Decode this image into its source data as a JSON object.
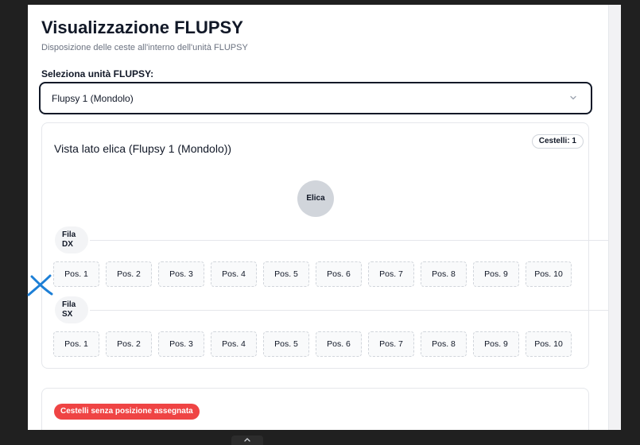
{
  "page": {
    "title": "Visualizzazione FLUPSY",
    "subtitle": "Disposizione delle ceste all'interno dell'unità FLUPSY"
  },
  "selector": {
    "label": "Seleziona unità FLUPSY:",
    "value": "Flupsy 1 (Mondolo)"
  },
  "view": {
    "title": "Vista lato elica (Flupsy 1 (Mondolo))",
    "count_badge": "Cestelli: 1",
    "propeller_label": "Elica",
    "rows": [
      {
        "label_line1": "Fila",
        "label_line2": "DX"
      },
      {
        "label_line1": "Fila",
        "label_line2": "SX"
      }
    ],
    "positions": [
      "Pos. 1",
      "Pos. 2",
      "Pos. 3",
      "Pos. 4",
      "Pos. 5",
      "Pos. 6",
      "Pos. 7",
      "Pos. 8",
      "Pos. 9",
      "Pos. 10"
    ]
  },
  "unassigned": {
    "badge": "Cestelli senza posizione assegnata"
  },
  "colors": {
    "badge_red": "#ef4444",
    "annotation_blue": "#1d7fd6"
  },
  "icons": [
    "chevron-down-icon",
    "chevron-up-icon",
    "annotation-cross-mark"
  ]
}
